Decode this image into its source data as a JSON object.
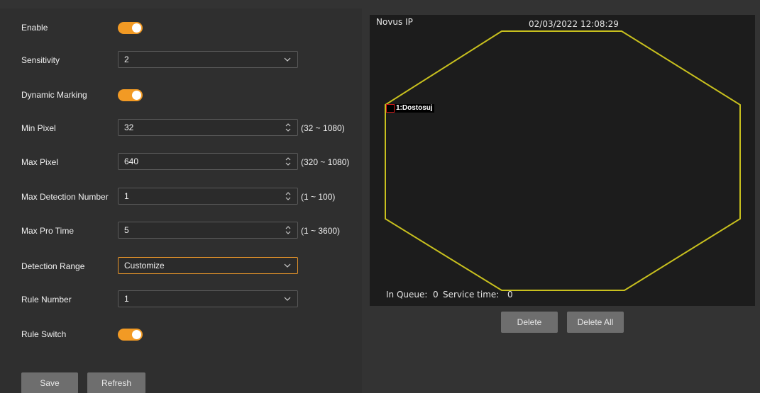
{
  "colors": {
    "accent": "#f29a24",
    "region_outline": "#c8c01e",
    "rule_marker": "#d41a1a"
  },
  "form": {
    "enable": {
      "label": "Enable",
      "on": true
    },
    "sensitivity": {
      "label": "Sensitivity",
      "value": "2"
    },
    "dynamic_marking": {
      "label": "Dynamic Marking",
      "on": true
    },
    "min_pixel": {
      "label": "Min Pixel",
      "value": "32",
      "range": "(32 ~ 1080)"
    },
    "max_pixel": {
      "label": "Max Pixel",
      "value": "640",
      "range": "(320 ~ 1080)"
    },
    "max_detection_number": {
      "label": "Max Detection Number",
      "value": "1",
      "range": "(1 ~ 100)"
    },
    "max_pro_time": {
      "label": "Max Pro Time",
      "value": "5",
      "range": "(1 ~ 3600)"
    },
    "detection_range": {
      "label": "Detection Range",
      "value": "Customize"
    },
    "rule_number": {
      "label": "Rule Number",
      "value": "1"
    },
    "rule_switch": {
      "label": "Rule Switch",
      "on": true
    }
  },
  "buttons": {
    "save": "Save",
    "refresh": "Refresh",
    "delete": "Delete",
    "delete_all": "Delete All"
  },
  "video": {
    "camera_name": "Novus IP",
    "timestamp": "02/03/2022 12:08:29",
    "rule_label": "1:Dostosuj",
    "queue_label": "In Queue:",
    "queue_value": "0",
    "service_label": "Service time:",
    "service_value": "0"
  }
}
